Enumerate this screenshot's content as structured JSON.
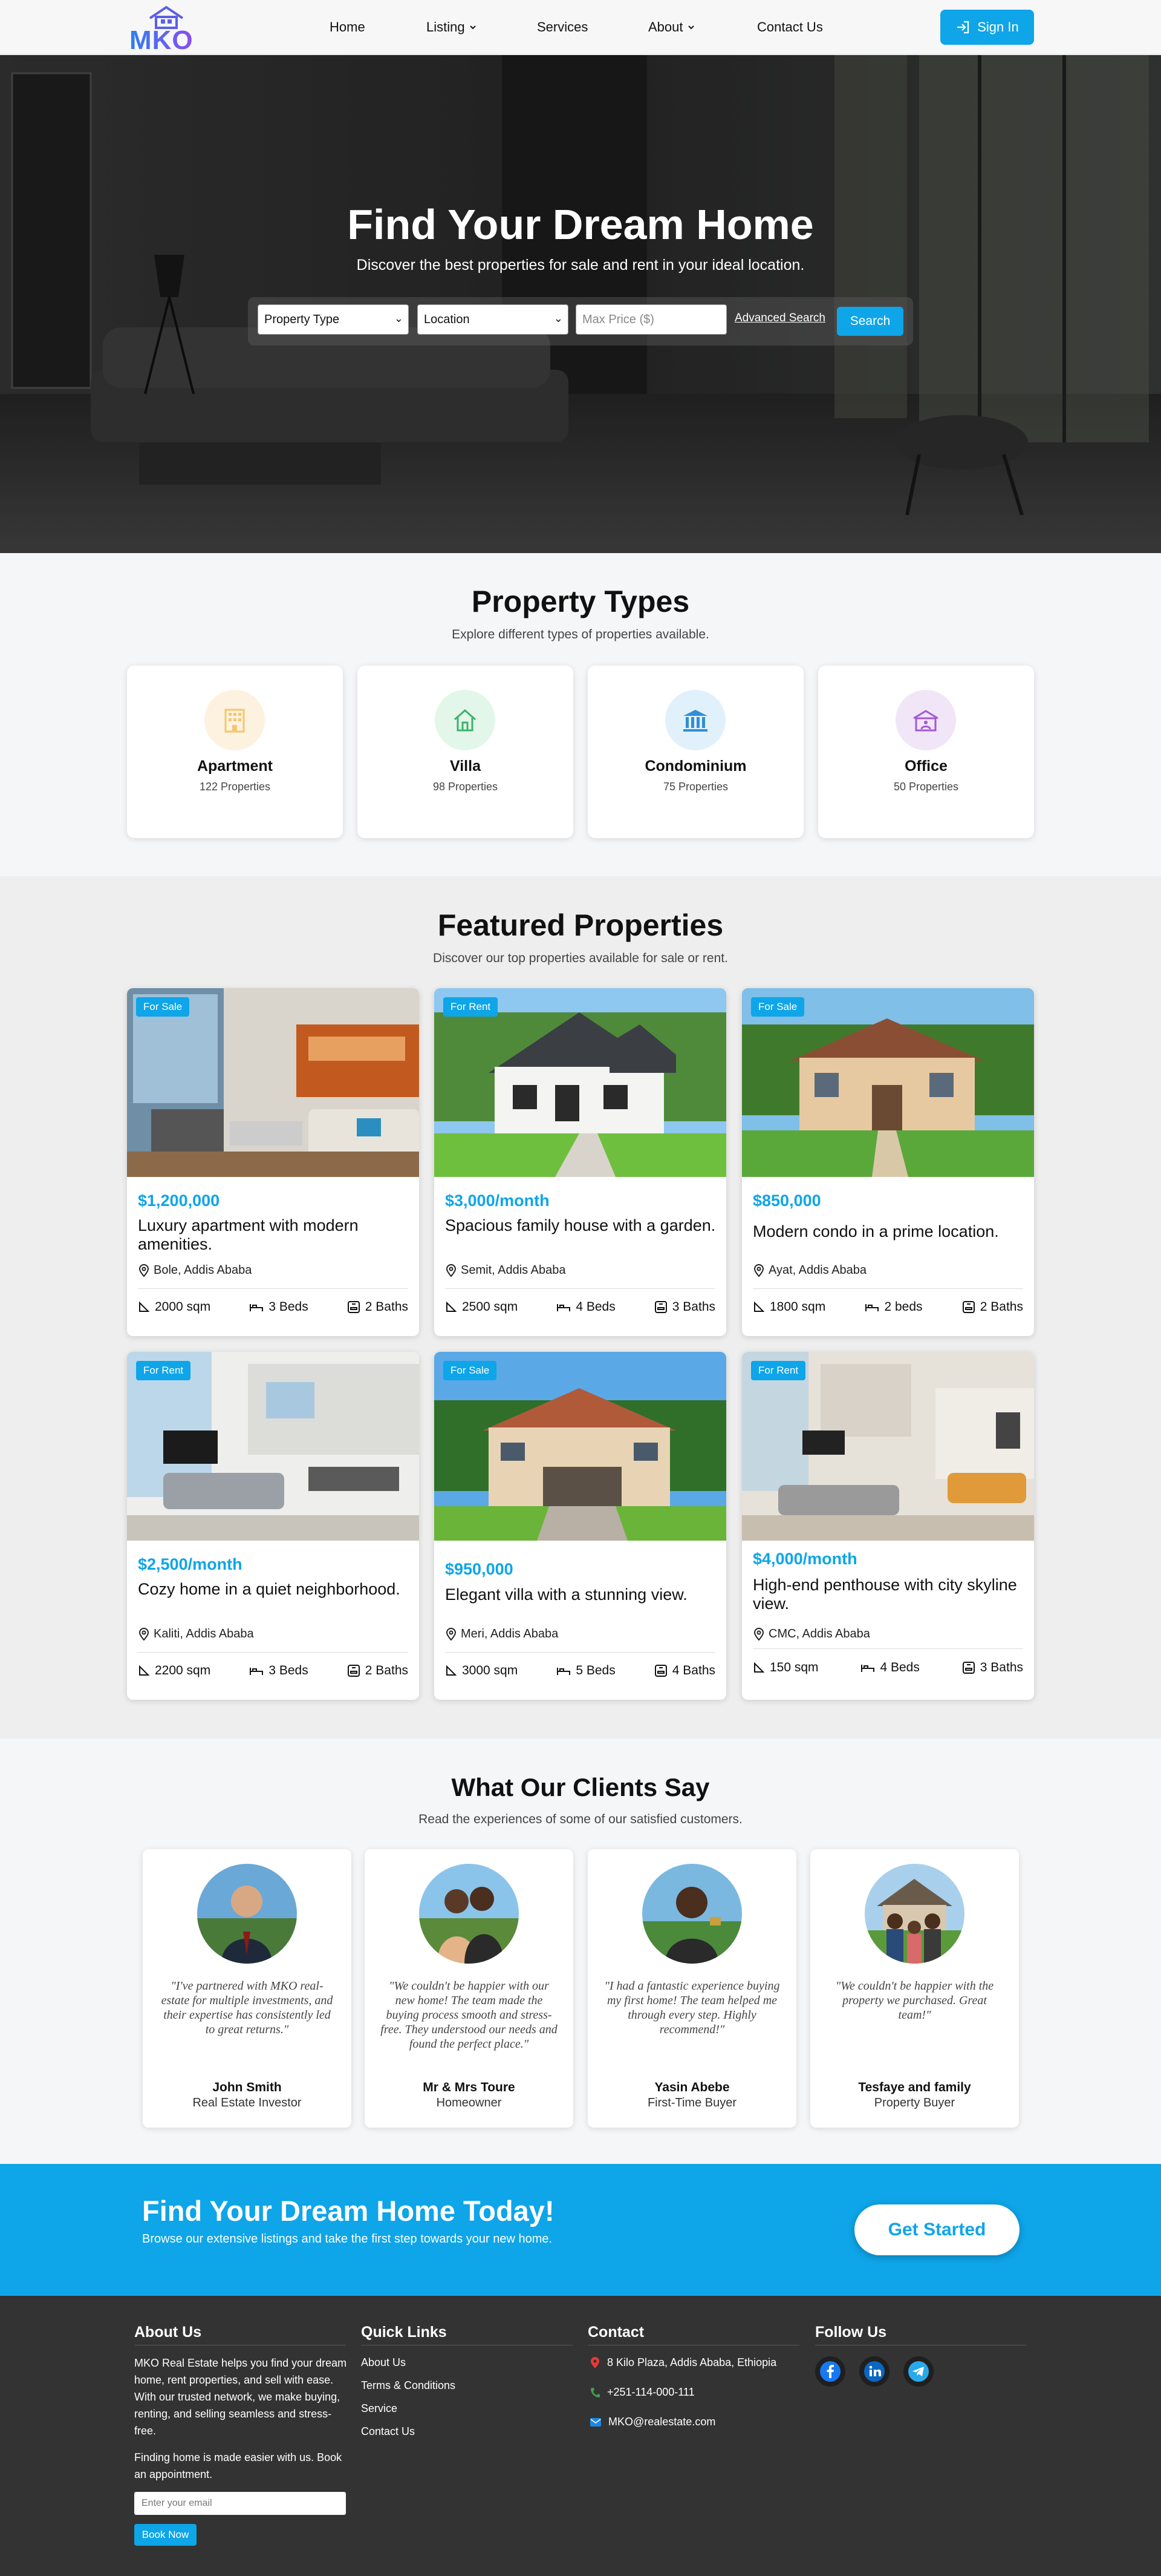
{
  "header": {
    "logo_text": "MKO",
    "nav": [
      {
        "label": "Home"
      },
      {
        "label": "Listing",
        "has_dropdown": true
      },
      {
        "label": "Services"
      },
      {
        "label": "About",
        "has_dropdown": true
      },
      {
        "label": "Contact Us"
      }
    ],
    "sign_in_label": "Sign In"
  },
  "hero": {
    "title": "Find Your Dream Home",
    "subtitle": "Discover the best properties for sale and rent in your ideal location.",
    "search": {
      "property_type": "Property Type",
      "location": "Location",
      "max_price_placeholder": "Max Price ($)",
      "advanced_link": "Advanced Search",
      "search_button": "Search"
    }
  },
  "property_types": {
    "title": "Property Types",
    "subtitle": "Explore different types of properties available.",
    "items": [
      {
        "name": "Apartment",
        "count": "122 Properties",
        "icon": "building-icon",
        "tint": "#fdf1e0",
        "color": "#f2c86a"
      },
      {
        "name": "Villa",
        "count": "98 Properties",
        "icon": "house-icon",
        "tint": "#e3f6ea",
        "color": "#3cb36a"
      },
      {
        "name": "Condominium",
        "count": "75 Properties",
        "icon": "condominium-icon",
        "tint": "#e1f1fb",
        "color": "#2f8fd6"
      },
      {
        "name": "Office",
        "count": "50 Properties",
        "icon": "office-icon",
        "tint": "#f1e6f8",
        "color": "#a458d6"
      }
    ]
  },
  "featured": {
    "title": "Featured Properties",
    "subtitle": "Discover our top properties available for sale or rent.",
    "items": [
      {
        "badge": "For Sale",
        "price": "$1,200,000",
        "title": "Luxury apartment with modern amenities.",
        "location": "Bole, Addis Ababa",
        "area": "2000 sqm",
        "beds": "3 Beds",
        "baths": "2 Baths"
      },
      {
        "badge": "For Rent",
        "price": "$3,000/month",
        "title": "Spacious family house with a garden.",
        "location": "Semit, Addis Ababa",
        "area": "2500 sqm",
        "beds": "4 Beds",
        "baths": "3 Baths"
      },
      {
        "badge": "For Sale",
        "price": "$850,000",
        "title": "Modern condo in a prime location.",
        "location": "Ayat, Addis Ababa",
        "area": "1800 sqm",
        "beds": "2 beds",
        "baths": "2 Baths"
      },
      {
        "badge": "For Rent",
        "price": "$2,500/month",
        "title": "Cozy home in a quiet neighborhood.",
        "location": "Kaliti, Addis Ababa",
        "area": "2200 sqm",
        "beds": "3 Beds",
        "baths": "2 Baths"
      },
      {
        "badge": "For Sale",
        "price": "$950,000",
        "title": "Elegant villa with a stunning view.",
        "location": "Meri, Addis Ababa",
        "area": "3000 sqm",
        "beds": "5 Beds",
        "baths": "4 Baths"
      },
      {
        "badge": "For Rent",
        "price": "$4,000/month",
        "title": "High-end penthouse with city skyline view.",
        "location": "CMC, Addis Ababa",
        "area": "150 sqm",
        "beds": "4 Beds",
        "baths": "3 Baths"
      }
    ]
  },
  "testimonials": {
    "title": "What Our Clients Say",
    "subtitle": "Read the experiences of some of our satisfied customers.",
    "items": [
      {
        "quote": "\"I've partnered with MKO real-estate for multiple investments, and their expertise has consistently led to great returns.\"",
        "name": "John Smith",
        "role": "Real Estate Investor"
      },
      {
        "quote": "\"We couldn't be happier with our new home! The team made the buying process smooth and stress-free. They understood our needs and found the perfect place.\"",
        "name": "Mr & Mrs Toure",
        "role": "Homeowner"
      },
      {
        "quote": "\"I had a fantastic experience buying my first home! The team helped me through every step. Highly recommend!\"",
        "name": "Yasin Abebe",
        "role": "First-Time Buyer"
      },
      {
        "quote": "\"We couldn't be happier with the property we purchased. Great team!\"",
        "name": "Tesfaye and family",
        "role": "Property Buyer"
      }
    ]
  },
  "cta": {
    "title": "Find Your Dream Home Today!",
    "subtitle": "Browse our extensive listings and take the first step towards your new home.",
    "button": "Get Started"
  },
  "footer": {
    "about_heading": "About Us",
    "about_text": "MKO Real Estate helps you find your dream home, rent properties, and sell with ease. With our trusted network, we make buying, renting, and selling seamless and stress-free.",
    "tagline": "Finding home is made easier with us. Book an appointment.",
    "email_placeholder": "Enter your email",
    "book_button": "Book Now",
    "links_heading": "Quick Links",
    "links": [
      "About Us",
      "Terms & Conditions",
      "Service",
      "Contact Us"
    ],
    "contact_heading": "Contact",
    "address": "8 Kilo Plaza, Addis Ababa, Ethiopia",
    "phone": "+251-114-000-111",
    "email": "MKO@realestate.com",
    "follow_heading": "Follow Us",
    "socials": [
      "facebook-icon",
      "linkedin-icon",
      "telegram-icon"
    ]
  },
  "colors": {
    "accent": "#0ea5e9",
    "footer": "#333333"
  }
}
